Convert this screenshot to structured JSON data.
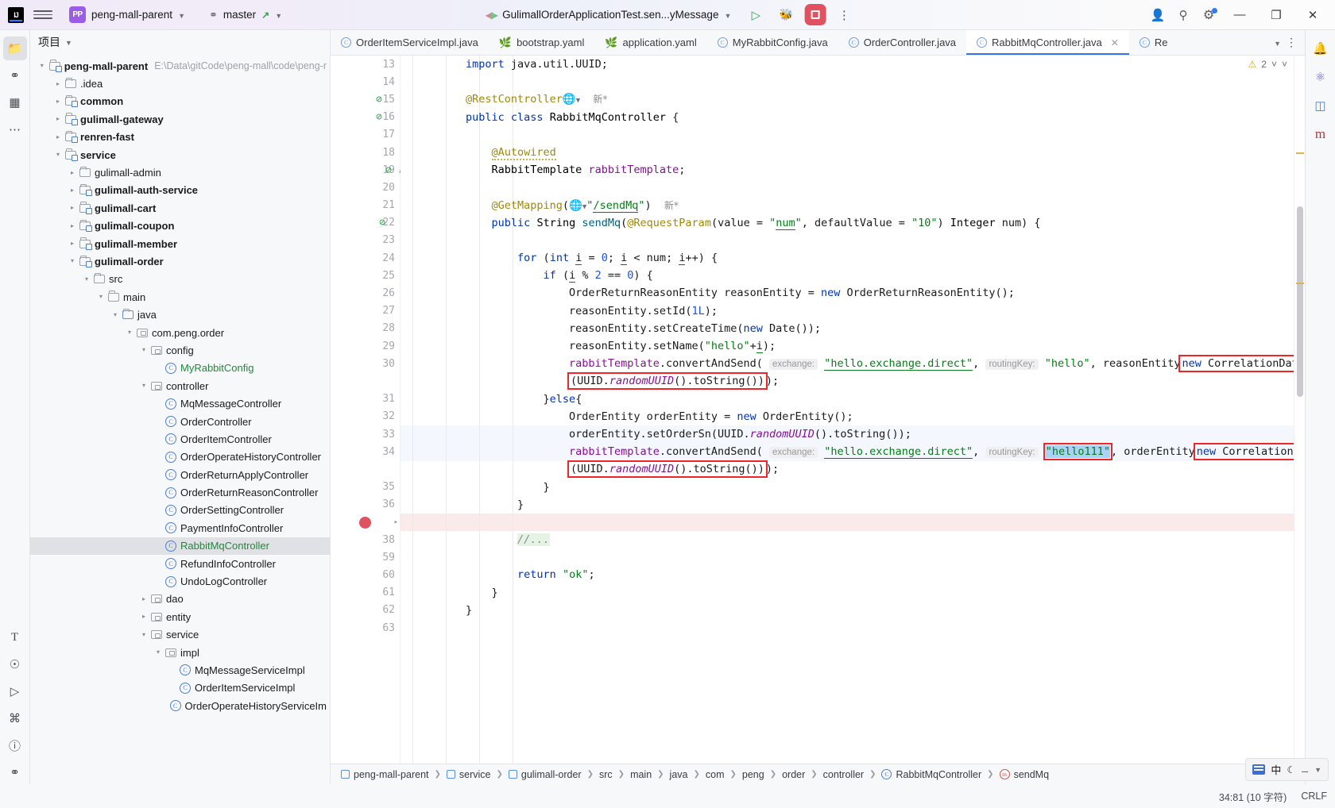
{
  "titlebar": {
    "logo": "IJ",
    "menu_icon": "hamburger-menu-icon",
    "project_badge": "PP",
    "project_name": "peng-mall-parent",
    "branch_icon": "git-branch-icon",
    "branch_name": "master",
    "run_config": "GulimallOrderApplicationTest.sen...yMessage",
    "run_label": "run-button",
    "debug_label": "debug-button",
    "stop_label": "stop-button",
    "more_label": "more-options-button",
    "account_label": "account-button",
    "search_label": "search-button",
    "settings_label": "settings-button",
    "minimize": "—",
    "maximize": "❐",
    "close": "✕"
  },
  "leftrail": {
    "items": [
      {
        "name": "project-tool-icon",
        "glyph": "▧",
        "active": true
      },
      {
        "name": "commit-tool-icon",
        "glyph": "⎇",
        "active": false
      },
      {
        "name": "structure-tool-icon",
        "glyph": "⊞",
        "active": false
      },
      {
        "name": "more-tool-icon",
        "glyph": "⋯",
        "active": false
      }
    ],
    "bottom": [
      {
        "name": "todo-tool-icon",
        "glyph": "T"
      },
      {
        "name": "services-tool-icon",
        "glyph": "⚙"
      },
      {
        "name": "run-tool-icon",
        "glyph": "▷"
      },
      {
        "name": "terminal-tool-icon",
        "glyph": "⬚"
      },
      {
        "name": "problems-tool-icon",
        "glyph": "ⓘ"
      },
      {
        "name": "git-tool-icon",
        "glyph": "⎇"
      }
    ]
  },
  "rightrail": {
    "items": [
      {
        "name": "notifications-icon",
        "glyph": "ὑ4"
      },
      {
        "name": "ai-assistant-icon",
        "glyph": "Ⓐ"
      },
      {
        "name": "database-icon",
        "glyph": "⛃"
      },
      {
        "name": "maven-icon",
        "glyph": "m"
      }
    ]
  },
  "project": {
    "header": "项目",
    "header_chevron": "chevron-down-icon",
    "tree": [
      {
        "depth": 0,
        "arrow": "down",
        "icon": "module",
        "label": "peng-mall-parent",
        "bold": true,
        "path": "E:\\Data\\gitCode\\peng-mall\\code\\peng-r"
      },
      {
        "depth": 1,
        "arrow": "right",
        "icon": "folder",
        "label": ".idea",
        "bold": false
      },
      {
        "depth": 1,
        "arrow": "right",
        "icon": "module",
        "label": "common",
        "bold": true
      },
      {
        "depth": 1,
        "arrow": "right",
        "icon": "module",
        "label": "gulimall-gateway",
        "bold": true
      },
      {
        "depth": 1,
        "arrow": "right",
        "icon": "module",
        "label": "renren-fast",
        "bold": true
      },
      {
        "depth": 1,
        "arrow": "down",
        "icon": "module",
        "label": "service",
        "bold": true
      },
      {
        "depth": 2,
        "arrow": "right",
        "icon": "folder",
        "label": "gulimall-admin",
        "bold": false
      },
      {
        "depth": 2,
        "arrow": "right",
        "icon": "module",
        "label": "gulimall-auth-service",
        "bold": true
      },
      {
        "depth": 2,
        "arrow": "right",
        "icon": "module",
        "label": "gulimall-cart",
        "bold": true
      },
      {
        "depth": 2,
        "arrow": "right",
        "icon": "module",
        "label": "gulimall-coupon",
        "bold": true
      },
      {
        "depth": 2,
        "arrow": "right",
        "icon": "module",
        "label": "gulimall-member",
        "bold": true
      },
      {
        "depth": 2,
        "arrow": "down",
        "icon": "module",
        "label": "gulimall-order",
        "bold": true
      },
      {
        "depth": 3,
        "arrow": "down",
        "icon": "folder",
        "label": "src",
        "bold": false
      },
      {
        "depth": 4,
        "arrow": "down",
        "icon": "folder",
        "label": "main",
        "bold": false
      },
      {
        "depth": 5,
        "arrow": "down",
        "icon": "folder-src",
        "label": "java",
        "bold": false
      },
      {
        "depth": 6,
        "arrow": "down",
        "icon": "package",
        "label": "com.peng.order",
        "bold": false
      },
      {
        "depth": 7,
        "arrow": "down",
        "icon": "package",
        "label": "config",
        "bold": false
      },
      {
        "depth": 8,
        "arrow": "none",
        "icon": "class",
        "label": "MyRabbitConfig",
        "bold": false,
        "green": true
      },
      {
        "depth": 7,
        "arrow": "down",
        "icon": "package",
        "label": "controller",
        "bold": false
      },
      {
        "depth": 8,
        "arrow": "none",
        "icon": "class",
        "label": "MqMessageController",
        "bold": false
      },
      {
        "depth": 8,
        "arrow": "none",
        "icon": "class",
        "label": "OrderController",
        "bold": false
      },
      {
        "depth": 8,
        "arrow": "none",
        "icon": "class",
        "label": "OrderItemController",
        "bold": false
      },
      {
        "depth": 8,
        "arrow": "none",
        "icon": "class",
        "label": "OrderOperateHistoryController",
        "bold": false
      },
      {
        "depth": 8,
        "arrow": "none",
        "icon": "class",
        "label": "OrderReturnApplyController",
        "bold": false
      },
      {
        "depth": 8,
        "arrow": "none",
        "icon": "class",
        "label": "OrderReturnReasonController",
        "bold": false
      },
      {
        "depth": 8,
        "arrow": "none",
        "icon": "class",
        "label": "OrderSettingController",
        "bold": false
      },
      {
        "depth": 8,
        "arrow": "none",
        "icon": "class",
        "label": "PaymentInfoController",
        "bold": false
      },
      {
        "depth": 8,
        "arrow": "none",
        "icon": "class",
        "label": "RabbitMqController",
        "bold": false,
        "green": true,
        "selected": true
      },
      {
        "depth": 8,
        "arrow": "none",
        "icon": "class",
        "label": "RefundInfoController",
        "bold": false
      },
      {
        "depth": 8,
        "arrow": "none",
        "icon": "class",
        "label": "UndoLogController",
        "bold": false
      },
      {
        "depth": 7,
        "arrow": "right",
        "icon": "package",
        "label": "dao",
        "bold": false
      },
      {
        "depth": 7,
        "arrow": "right",
        "icon": "package",
        "label": "entity",
        "bold": false
      },
      {
        "depth": 7,
        "arrow": "down",
        "icon": "package",
        "label": "service",
        "bold": false
      },
      {
        "depth": 8,
        "arrow": "down",
        "icon": "package",
        "label": "impl",
        "bold": false
      },
      {
        "depth": 9,
        "arrow": "none",
        "icon": "class",
        "label": "MqMessageServiceImpl",
        "bold": false
      },
      {
        "depth": 9,
        "arrow": "none",
        "icon": "class",
        "label": "OrderItemServiceImpl",
        "bold": false
      },
      {
        "depth": 9,
        "arrow": "none",
        "icon": "class",
        "label": "OrderOperateHistoryServiceIm",
        "bold": false
      }
    ]
  },
  "tabs": [
    {
      "label": "OrderItemServiceImpl.java",
      "icon": "java-class-icon",
      "active": false,
      "type": "class"
    },
    {
      "label": "bootstrap.yaml",
      "icon": "yaml-icon",
      "active": false,
      "type": "yaml"
    },
    {
      "label": "application.yaml",
      "icon": "yaml-icon",
      "active": false,
      "type": "yaml"
    },
    {
      "label": "MyRabbitConfig.java",
      "icon": "java-class-icon",
      "active": false,
      "type": "class"
    },
    {
      "label": "OrderController.java",
      "icon": "java-class-icon",
      "active": false,
      "type": "class"
    },
    {
      "label": "RabbitMqController.java",
      "icon": "java-class-icon",
      "active": true,
      "type": "class",
      "closable": true
    },
    {
      "label": "Re",
      "icon": "java-class-icon",
      "active": false,
      "type": "class",
      "truncated": true
    }
  ],
  "editor": {
    "warning_count": "2",
    "warning_icon": "warning-triangle-icon",
    "prev_icon": "chevron-up-icon",
    "next_icon": "chevron-down-icon",
    "lines": [
      {
        "num": "13",
        "text": "import java.util.UUID;"
      },
      {
        "num": "14",
        "text": ""
      },
      {
        "num": "15",
        "text": "@RestController  新*",
        "gutter_icons": [
          "no-usage-icon"
        ]
      },
      {
        "num": "16",
        "text": "public class RabbitMqController {",
        "gutter_icons": [
          "no-usage-icon"
        ]
      },
      {
        "num": "17",
        "text": ""
      },
      {
        "num": "18",
        "text": "    @Autowired"
      },
      {
        "num": "19",
        "text": "    RabbitTemplate rabbitTemplate;",
        "gutter_icons": [
          "no-usage-icon",
          "bean-icon"
        ]
      },
      {
        "num": "20",
        "text": ""
      },
      {
        "num": "21",
        "text": "    @GetMapping(\"/sendMq\")  新*"
      },
      {
        "num": "22",
        "text": "    public String sendMq(@RequestParam(value = \"num\", defaultValue = \"10\") Integer num) {",
        "gutter_icons": [
          "url-mapping-icon"
        ]
      },
      {
        "num": "23",
        "text": ""
      },
      {
        "num": "24",
        "text": "        for (int i = 0; i < num; i++) {"
      },
      {
        "num": "25",
        "text": "            if (i % 2 == 0) {"
      },
      {
        "num": "26",
        "text": "                OrderReturnReasonEntity reasonEntity = new OrderReturnReasonEntity();"
      },
      {
        "num": "27",
        "text": "                reasonEntity.setId(1L);"
      },
      {
        "num": "28",
        "text": "                reasonEntity.setCreateTime(new Date());"
      },
      {
        "num": "29",
        "text": "                reasonEntity.setName(\"hello\"+i);"
      },
      {
        "num": "30",
        "text": "                rabbitTemplate.convertAndSend( exchange: \"hello.exchange.direct\", routingKey: \"hello\", reasonEntity, new CorrelationData"
      },
      {
        "num": "",
        "text": "                (UUID.randomUUID().toString()));"
      },
      {
        "num": "31",
        "text": "            }else{"
      },
      {
        "num": "32",
        "text": "                OrderEntity orderEntity = new OrderEntity();"
      },
      {
        "num": "33",
        "text": "                orderEntity.setOrderSn(UUID.randomUUID().toString());"
      },
      {
        "num": "34",
        "text": "                rabbitTemplate.convertAndSend( exchange: \"hello.exchange.direct\", routingKey: \"hello111\", orderEntity, new CorrelationData",
        "current": true
      },
      {
        "num": "",
        "text": "                (UUID.randomUUID().toString()));"
      },
      {
        "num": "35",
        "text": "            }"
      },
      {
        "num": "36",
        "text": "        }"
      },
      {
        "num": "37",
        "text": ""
      },
      {
        "num": "38",
        "text": "        //...",
        "breakpoint": true,
        "folded": true
      },
      {
        "num": "59",
        "text": ""
      },
      {
        "num": "60",
        "text": "        return \"ok\";"
      },
      {
        "num": "61",
        "text": "    }"
      },
      {
        "num": "62",
        "text": "}"
      },
      {
        "num": "63",
        "text": ""
      }
    ],
    "annotations": {
      "exchange_hint": "exchange:",
      "routing_key_hint": "routingKey:",
      "new_badge": "新",
      "highlighted_value": "\"hello111\""
    }
  },
  "breadcrumb": {
    "items": [
      {
        "label": "peng-mall-parent",
        "icon": "module-icon"
      },
      {
        "label": "service",
        "icon": "module-icon"
      },
      {
        "label": "gulimall-order",
        "icon": "module-icon"
      },
      {
        "label": "src",
        "icon": "none"
      },
      {
        "label": "main",
        "icon": "none"
      },
      {
        "label": "java",
        "icon": "none"
      },
      {
        "label": "com",
        "icon": "none"
      },
      {
        "label": "peng",
        "icon": "none"
      },
      {
        "label": "order",
        "icon": "none"
      },
      {
        "label": "controller",
        "icon": "none"
      },
      {
        "label": "RabbitMqController",
        "icon": "class-icon"
      },
      {
        "label": "sendMq",
        "icon": "method-icon"
      }
    ],
    "caret_position": "34:81 (10 字符)",
    "line_separator": "CRLF"
  },
  "tray": {
    "ime_mode": "中",
    "items": [
      "keyboard-icon",
      "ime-chinese-icon",
      "moon-icon",
      "pin-icon",
      "chevron-icon"
    ]
  },
  "colors": {
    "accent": "#3573f0",
    "highlight_box": "#ef2626",
    "selection_blue": "#a9d3f5",
    "string_green": "#067d17",
    "keyword_blue": "#0033b3",
    "annotation_gold": "#9e880d",
    "field_purple": "#871094",
    "stop_red": "#e05260",
    "project_badge": "#9b5de5"
  }
}
